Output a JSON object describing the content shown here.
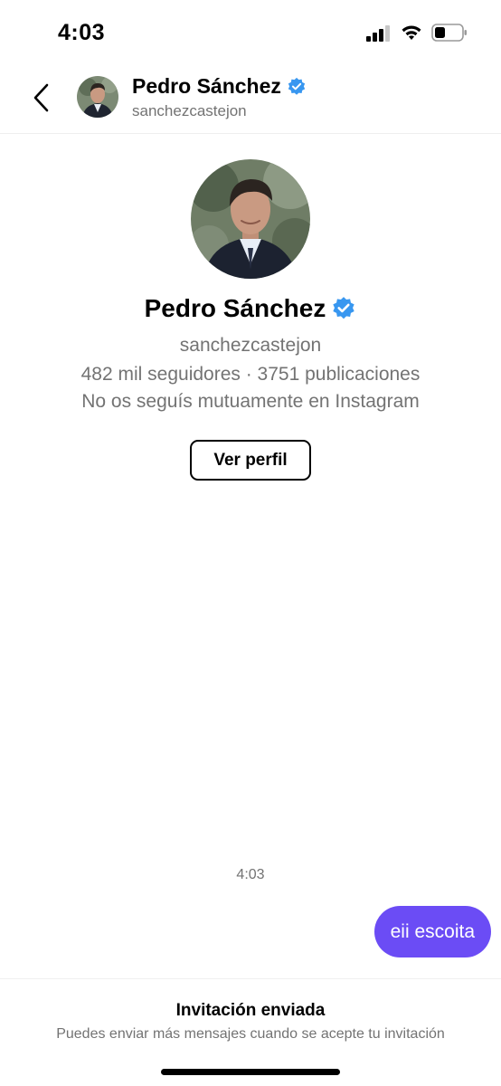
{
  "status_bar": {
    "time": "4:03"
  },
  "header": {
    "name": "Pedro Sánchez",
    "username": "sanchezcastejon"
  },
  "profile": {
    "name": "Pedro Sánchez",
    "username": "sanchezcastejon",
    "stats": "482 mil seguidores · 3751 publicaciones",
    "mutual": "No os seguís mutuamente en Instagram",
    "view_profile_label": "Ver perfil"
  },
  "chat": {
    "timestamp": "4:03",
    "messages": [
      {
        "text": "eii escoita",
        "sender": "me"
      }
    ]
  },
  "footer": {
    "title": "Invitación enviada",
    "subtitle": "Puedes enviar más mensajes cuando se acepte tu invitación"
  },
  "colors": {
    "accent": "#6b4cf5",
    "verified": "#3897f0",
    "secondary_text": "#737373"
  },
  "icons": [
    "back-chevron-icon",
    "verified-badge-icon",
    "signal-icon",
    "wifi-icon",
    "battery-icon"
  ]
}
